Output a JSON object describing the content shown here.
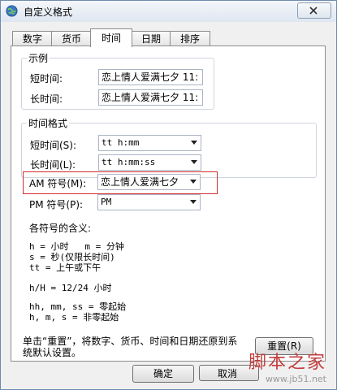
{
  "window": {
    "title": "自定义格式"
  },
  "tabs": [
    {
      "label": "数字"
    },
    {
      "label": "货币"
    },
    {
      "label": "时间",
      "active": true
    },
    {
      "label": "日期"
    },
    {
      "label": "排序"
    }
  ],
  "examples": {
    "group_label": "示例",
    "short_label": "短时间:",
    "short_value": "恋上情人爱满七夕 11:",
    "long_label": "长时间:",
    "long_value": "恋上情人爱满七夕 11:"
  },
  "time_formats": {
    "group_label": "时间格式",
    "short_label": "短时间(S):",
    "short_value": "tt h:mm",
    "long_label": "长时间(L):",
    "long_value": "tt h:mm:ss"
  },
  "am_symbol": {
    "label": "AM 符号(M):",
    "value": "恋上情人爱满七夕"
  },
  "pm_symbol": {
    "label": "PM 符号(P):",
    "value": "PM"
  },
  "legend": {
    "title": "各符号的含义:",
    "line1": "h = 小时   m = 分钟",
    "line2": "s = 秒(仅限长时间)",
    "line3": "tt = 上午或下午",
    "line4": "h/H = 12/24 小时",
    "line5": "hh, mm, ss = 零起始",
    "line6": "h, m, s = 非零起始"
  },
  "reset": {
    "text_line1": "单击“重置”，将数字、货币、时间和日期还原到系",
    "text_line2": "统默认设置。",
    "button": "重置(R)"
  },
  "buttons": {
    "ok": "确定",
    "cancel": "取消"
  },
  "watermark": {
    "brand": "脚本之家",
    "url": "www.jb51.net"
  }
}
